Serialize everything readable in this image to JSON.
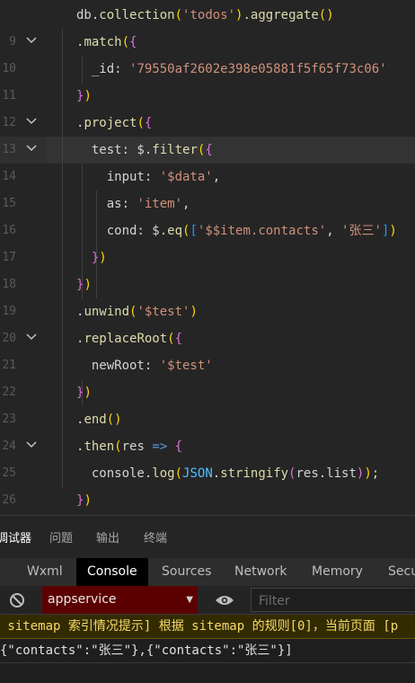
{
  "editor": {
    "lines": [
      {
        "num": "",
        "fold": false,
        "tokens": [
          [
            "def",
            "db."
          ],
          [
            "fn",
            "collection"
          ],
          [
            "paren",
            "("
          ],
          [
            "str",
            "'todos'"
          ],
          [
            "paren",
            ")"
          ],
          [
            "def",
            "."
          ],
          [
            "fn",
            "aggregate"
          ],
          [
            "paren",
            "()"
          ]
        ]
      },
      {
        "num": "9",
        "fold": true,
        "tokens": [
          [
            "def",
            "."
          ],
          [
            "fn",
            "match"
          ],
          [
            "paren",
            "("
          ],
          [
            "brace",
            "{"
          ]
        ]
      },
      {
        "num": "10",
        "fold": false,
        "tokens": [
          [
            "def",
            "  _id: "
          ],
          [
            "str",
            "'79550af2602e398e05881f5f65f73c06'"
          ]
        ]
      },
      {
        "num": "11",
        "fold": false,
        "tokens": [
          [
            "brace",
            "}"
          ],
          [
            "paren",
            ")"
          ]
        ]
      },
      {
        "num": "12",
        "fold": true,
        "tokens": [
          [
            "def",
            "."
          ],
          [
            "fn",
            "project"
          ],
          [
            "paren",
            "("
          ],
          [
            "brace",
            "{"
          ]
        ]
      },
      {
        "num": "13",
        "fold": true,
        "active": true,
        "tokens": [
          [
            "def",
            "  test: $."
          ],
          [
            "fn",
            "filter"
          ],
          [
            "paren",
            "("
          ],
          [
            "brace",
            "{"
          ]
        ]
      },
      {
        "num": "14",
        "fold": false,
        "tokens": [
          [
            "def",
            "    input: "
          ],
          [
            "str",
            "'$data'"
          ],
          [
            "def",
            ","
          ]
        ]
      },
      {
        "num": "15",
        "fold": false,
        "tokens": [
          [
            "def",
            "    as: "
          ],
          [
            "str",
            "'item'"
          ],
          [
            "def",
            ","
          ]
        ]
      },
      {
        "num": "16",
        "fold": false,
        "tokens": [
          [
            "def",
            "    cond: $."
          ],
          [
            "fn",
            "eq"
          ],
          [
            "paren",
            "("
          ],
          [
            "brack",
            "["
          ],
          [
            "str",
            "'$$item.contacts'"
          ],
          [
            "def",
            ", "
          ],
          [
            "str",
            "'张三'"
          ],
          [
            "brack",
            "]"
          ],
          [
            "paren",
            ")"
          ]
        ]
      },
      {
        "num": "17",
        "fold": false,
        "tokens": [
          [
            "def",
            "  "
          ],
          [
            "brace",
            "}"
          ],
          [
            "paren",
            ")"
          ]
        ]
      },
      {
        "num": "18",
        "fold": false,
        "tokens": [
          [
            "brace",
            "}"
          ],
          [
            "paren",
            ")"
          ]
        ]
      },
      {
        "num": "19",
        "fold": false,
        "tokens": [
          [
            "def",
            "."
          ],
          [
            "fn",
            "unwind"
          ],
          [
            "paren",
            "("
          ],
          [
            "str",
            "'$test'"
          ],
          [
            "paren",
            ")"
          ]
        ]
      },
      {
        "num": "20",
        "fold": true,
        "tokens": [
          [
            "def",
            "."
          ],
          [
            "fn",
            "replaceRoot"
          ],
          [
            "paren",
            "("
          ],
          [
            "brace",
            "{"
          ]
        ]
      },
      {
        "num": "21",
        "fold": false,
        "tokens": [
          [
            "def",
            "  newRoot: "
          ],
          [
            "str",
            "'$test'"
          ]
        ]
      },
      {
        "num": "22",
        "fold": false,
        "tokens": [
          [
            "brace",
            "}"
          ],
          [
            "paren",
            ")"
          ]
        ]
      },
      {
        "num": "23",
        "fold": false,
        "tokens": [
          [
            "def",
            "."
          ],
          [
            "fn",
            "end"
          ],
          [
            "paren",
            "()"
          ]
        ]
      },
      {
        "num": "24",
        "fold": true,
        "tokens": [
          [
            "def",
            "."
          ],
          [
            "fn",
            "then"
          ],
          [
            "paren",
            "("
          ],
          [
            "def",
            "res "
          ],
          [
            "kw",
            "=>"
          ],
          [
            "def",
            " "
          ],
          [
            "brace",
            "{"
          ]
        ]
      },
      {
        "num": "25",
        "fold": false,
        "tokens": [
          [
            "def",
            "  console."
          ],
          [
            "fn",
            "log"
          ],
          [
            "paren",
            "("
          ],
          [
            "const",
            "JSON"
          ],
          [
            "def",
            "."
          ],
          [
            "fn",
            "stringify"
          ],
          [
            "brace",
            "("
          ],
          [
            "def",
            "res.list"
          ],
          [
            "brace",
            ")"
          ],
          [
            "paren",
            ")"
          ],
          [
            "def",
            ";"
          ]
        ]
      },
      {
        "num": "26",
        "fold": false,
        "tokens": [
          [
            "brace",
            "}"
          ],
          [
            "paren",
            ")"
          ]
        ]
      }
    ]
  },
  "panel_tabs": [
    {
      "label": "调试器",
      "active": true
    },
    {
      "label": "问题",
      "active": false
    },
    {
      "label": "输出",
      "active": false
    },
    {
      "label": "终端",
      "active": false
    }
  ],
  "devtools_tabs": [
    {
      "label": "Wxml",
      "active": false
    },
    {
      "label": "Console",
      "active": true
    },
    {
      "label": "Sources",
      "active": false
    },
    {
      "label": "Network",
      "active": false
    },
    {
      "label": "Memory",
      "active": false
    },
    {
      "label": "Secu",
      "active": false
    }
  ],
  "toolbar": {
    "block_icon": "block-icon",
    "context_value": "appservice",
    "eye_icon": "eye-icon",
    "filter_placeholder": "Filter"
  },
  "console": {
    "warning": " sitemap 索引情况提示] 根据 sitemap 的规则[0]，当前页面 [p",
    "output": "{\"contacts\":\"张三\"},{\"contacts\":\"张三\"}]"
  },
  "colors": {
    "context_bg": "#5b0000",
    "warning_bg": "#332b00",
    "warning_text": "#f5d96b",
    "editor_bg": "#252526"
  }
}
